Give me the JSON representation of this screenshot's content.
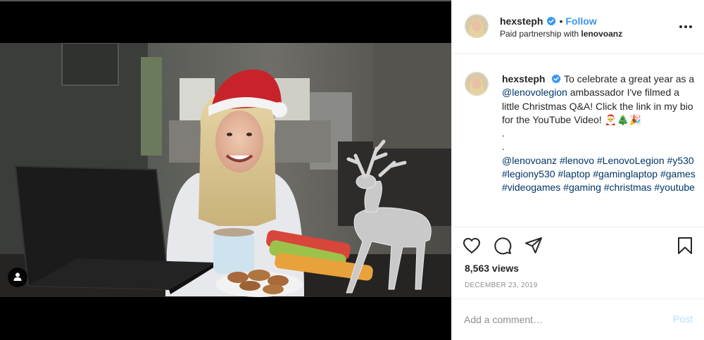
{
  "post": {
    "author": {
      "username": "hexsteph",
      "verified": true
    },
    "header": {
      "follow_label": "Follow",
      "partnership_prefix": "Paid partnership with",
      "partner": "lenovoanz"
    },
    "caption": {
      "text_1": "To celebrate a great year as a",
      "mention": "@lenovolegion",
      "text_2": "ambassador I've filmed a little Christmas Q&A! Click the link in my bio for the YouTube Video!",
      "emoji": "🎅🎄🎉",
      "dot": ".",
      "tags": [
        "@lenovoanz",
        "#lenovo",
        "#LenovoLegion",
        "#y530",
        "#legiony530",
        "#laptop",
        "#gaminglaptop",
        "#games",
        "#videogames",
        "#gaming",
        "#christmas",
        "#youtube"
      ]
    },
    "stats": {
      "views": "8,563 views",
      "date": "December 23, 2019"
    },
    "comment": {
      "placeholder": "Add a comment…",
      "post_label": "Post"
    },
    "colors": {
      "link_blue": "#3897f0",
      "hashtag": "#003569",
      "muted": "#8e8e8e",
      "verified_badge": "#3897f0"
    },
    "icons": {
      "like": "heart-icon",
      "comment": "comment-icon",
      "share": "share-icon",
      "save": "bookmark-icon",
      "more": "more-options-icon",
      "tags": "user-tag-icon"
    }
  }
}
